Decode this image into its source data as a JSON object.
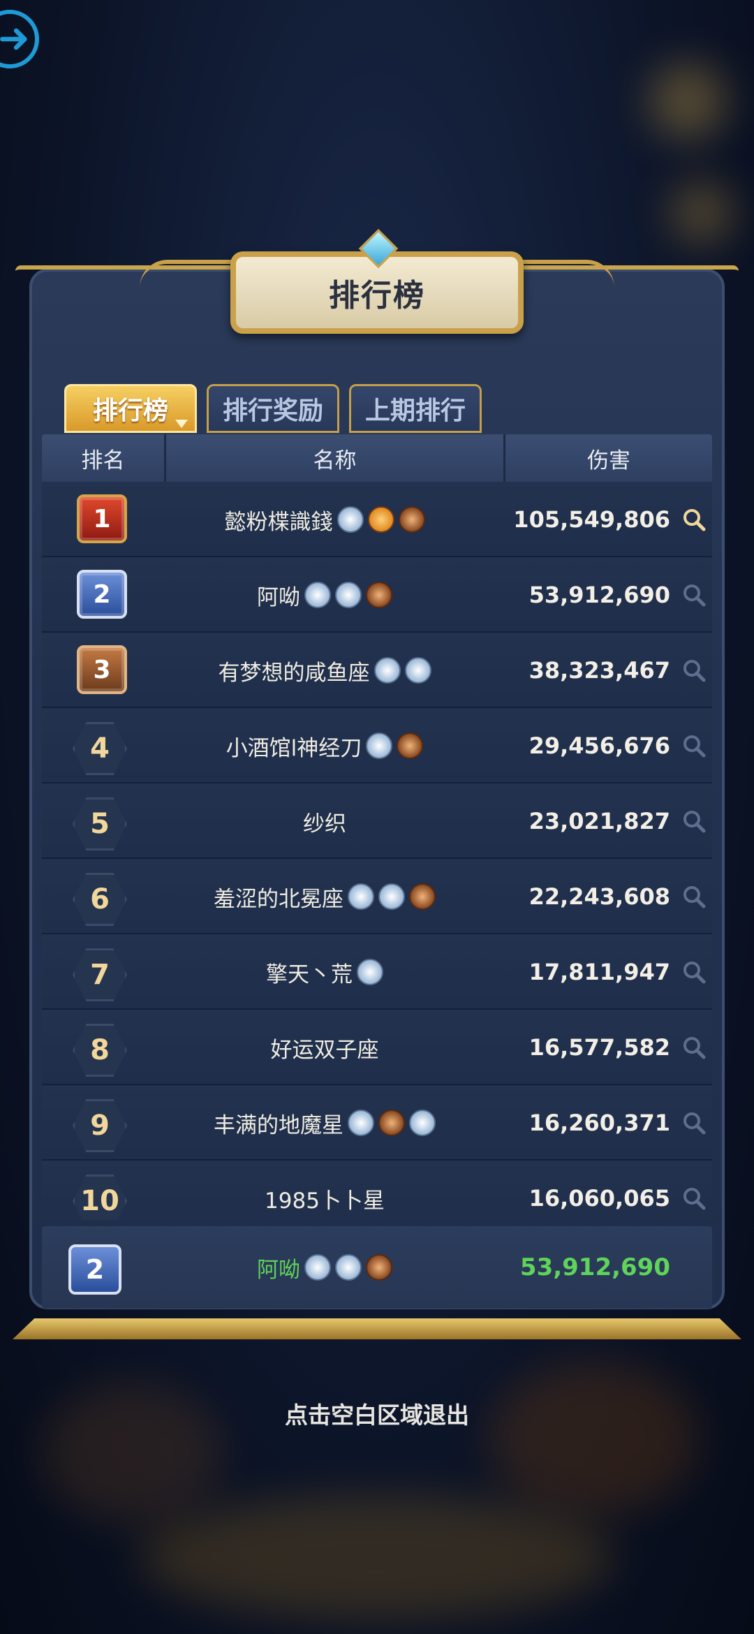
{
  "colors": {
    "accent_gold": "#d99a2a",
    "self_green": "#5fd35a",
    "panel": "#223250"
  },
  "header": {
    "title": "排行榜"
  },
  "tabs": [
    {
      "label": "排行榜",
      "active": true
    },
    {
      "label": "排行奖励",
      "active": false
    },
    {
      "label": "上期排行",
      "active": false
    }
  ],
  "table": {
    "columns": [
      "排名",
      "名称",
      "伤害"
    ],
    "rows": [
      {
        "rank": "1",
        "name": "懿粉楪識錢",
        "damage": "105,549,806",
        "badges": [
          "silver",
          "orange",
          "bronze"
        ]
      },
      {
        "rank": "2",
        "name": "阿呦",
        "damage": "53,912,690",
        "badges": [
          "silver",
          "silver",
          "bronze"
        ]
      },
      {
        "rank": "3",
        "name": "有梦想的咸鱼座",
        "damage": "38,323,467",
        "badges": [
          "silver",
          "silver"
        ]
      },
      {
        "rank": "4",
        "name": "小酒馆l神经刀",
        "damage": "29,456,676",
        "badges": [
          "silver",
          "bronze"
        ]
      },
      {
        "rank": "5",
        "name": "纱织",
        "damage": "23,021,827",
        "badges": []
      },
      {
        "rank": "6",
        "name": "羞涩的北冕座",
        "damage": "22,243,608",
        "badges": [
          "silver",
          "silver",
          "bronze"
        ]
      },
      {
        "rank": "7",
        "name": "擎天丶荒",
        "damage": "17,811,947",
        "badges": [
          "silver"
        ]
      },
      {
        "rank": "8",
        "name": "好运双子座",
        "damage": "16,577,582",
        "badges": []
      },
      {
        "rank": "9",
        "name": "丰满的地魔星",
        "damage": "16,260,371",
        "badges": [
          "silver",
          "bronze",
          "silver"
        ]
      },
      {
        "rank": "10",
        "name": "1985卜卜星",
        "damage": "16,060,065",
        "badges": []
      }
    ]
  },
  "me": {
    "rank": "2",
    "name": "阿呦",
    "damage": "53,912,690",
    "badges": [
      "silver",
      "silver",
      "bronze"
    ]
  },
  "footer": {
    "hint": "点击空白区域退出"
  }
}
